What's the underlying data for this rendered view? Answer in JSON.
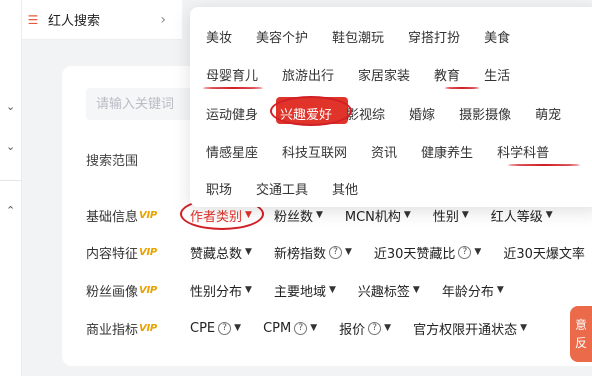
{
  "topnav": {
    "title": "红人搜索",
    "arrow": "›"
  },
  "search": {
    "placeholder": "请输入关键词"
  },
  "range": {
    "label": "搜索范围"
  },
  "rows": [
    {
      "label": "基础信息",
      "vip": "VIP",
      "filters": [
        "作者类别",
        "粉丝数",
        "MCN机构",
        "性别",
        "红人等级"
      ]
    },
    {
      "label": "内容特征",
      "vip": "VIP",
      "filters": [
        "赞藏总数",
        "新榜指数",
        "近30天赞藏比",
        "近30天爆文率"
      ]
    },
    {
      "label": "粉丝画像",
      "vip": "VIP",
      "filters": [
        "性别分布",
        "主要地域",
        "兴趣标签",
        "年龄分布"
      ]
    },
    {
      "label": "商业指标",
      "vip": "VIP",
      "filters": [
        "CPE",
        "CPM",
        "报价",
        "官方权限开通状态"
      ]
    }
  ],
  "popup": {
    "rows": [
      [
        "美妆",
        "美容个护",
        "鞋包潮玩",
        "穿搭打扮",
        "美食"
      ],
      [
        "母婴育儿",
        "旅游出行",
        "家居家装",
        "教育",
        "生活"
      ],
      [
        "运动健身",
        "兴趣爱好",
        "影视综",
        "婚嫁",
        "摄影摄像",
        "萌宠"
      ],
      [
        "情感星座",
        "科技互联网",
        "资讯",
        "健康养生",
        "科学科普"
      ],
      [
        "职场",
        "交通工具",
        "其他"
      ]
    ],
    "selected": "兴趣爱好"
  },
  "feedback": {
    "line1": "意",
    "line2": "反"
  },
  "colors": {
    "accent": "#e0342a",
    "vip": "#e8a200",
    "annotation": "#d11f26"
  }
}
